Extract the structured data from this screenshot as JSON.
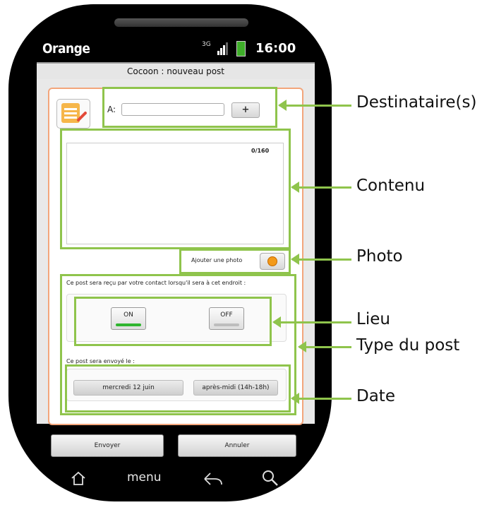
{
  "status_bar": {
    "carrier": "Orange",
    "network": "3G",
    "time": "16:00"
  },
  "app": {
    "title": "Cocoon :  nouveau post"
  },
  "recipient": {
    "label": "A:",
    "value": "",
    "add_label": "+"
  },
  "content": {
    "counter": "0/160",
    "value": ""
  },
  "photo": {
    "label": "Ajouter une photo"
  },
  "location": {
    "text": "Ce post sera reçu par votre contact lorsqu'il sera à cet endroit :",
    "on_label": "ON",
    "off_label": "OFF"
  },
  "schedule": {
    "text": "Ce post sera envoyé le :",
    "date": "mercredi 12 juin",
    "period": "après-midi (14h-18h)"
  },
  "actions": {
    "send_label": "Envoyer",
    "cancel_label": "Annuler"
  },
  "navbar": {
    "menu_label": "menu"
  },
  "annotations": {
    "recipients": "Destinataire(s)",
    "content": "Contenu",
    "photo": "Photo",
    "place": "Lieu",
    "post_type": "Type du post",
    "date": "Date"
  },
  "colors": {
    "annotation": "#8fc44c",
    "panel_border": "#f3a57b",
    "toggle_on": "#2fb52f"
  }
}
